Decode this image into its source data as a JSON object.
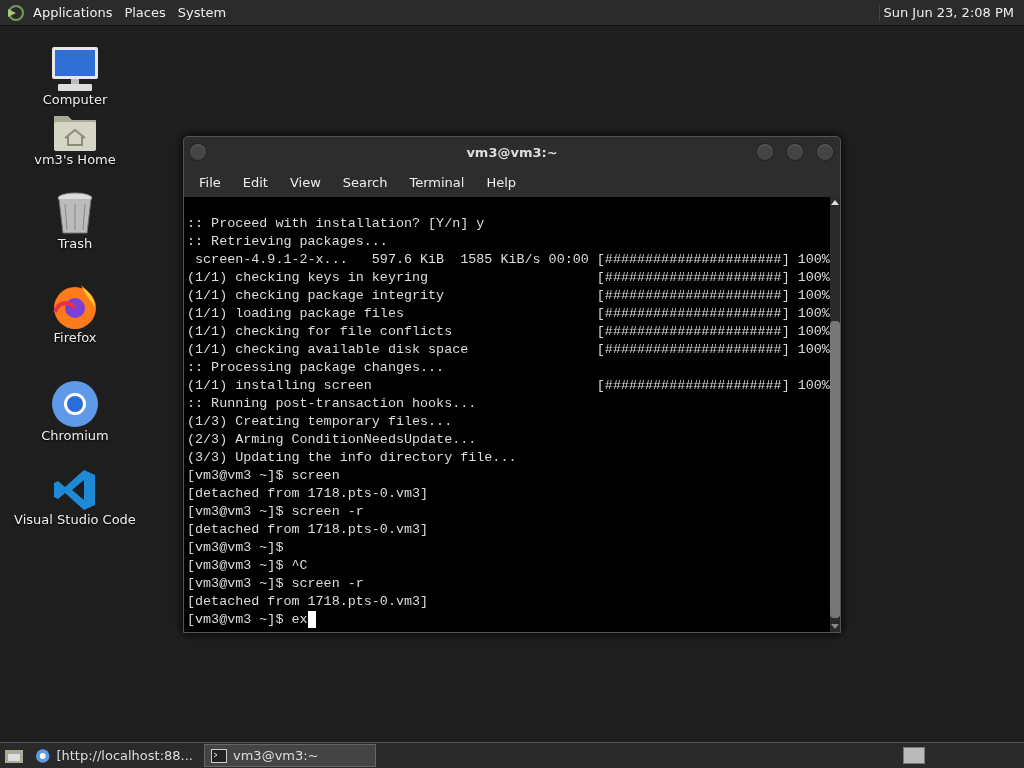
{
  "top_panel": {
    "menus": [
      "Applications",
      "Places",
      "System"
    ],
    "clock": "Sun Jun 23,  2:08 PM"
  },
  "desktop_icons": [
    {
      "kind": "computer",
      "label": "Computer"
    },
    {
      "kind": "home",
      "label": "vm3's Home"
    },
    {
      "kind": "trash",
      "label": "Trash"
    },
    {
      "kind": "firefox",
      "label": "Firefox"
    },
    {
      "kind": "chromium",
      "label": "Chromium"
    },
    {
      "kind": "vscode",
      "label": "Visual Studio Code"
    }
  ],
  "terminal_window": {
    "title": "vm3@vm3:~",
    "menus": [
      "File",
      "Edit",
      "View",
      "Search",
      "Terminal",
      "Help"
    ],
    "lines": [
      {
        "text": ":: Proceed with installation? [Y/n] y"
      },
      {
        "text": ":: Retrieving packages..."
      },
      {
        "text": " screen-4.9.1-2-x...   597.6 KiB  1585 KiB/s 00:00",
        "bar": "[######################]",
        "percent": "100%"
      },
      {
        "text": "(1/1) checking keys in keyring",
        "bar": "[######################]",
        "percent": "100%"
      },
      {
        "text": "(1/1) checking package integrity",
        "bar": "[######################]",
        "percent": "100%"
      },
      {
        "text": "(1/1) loading package files",
        "bar": "[######################]",
        "percent": "100%"
      },
      {
        "text": "(1/1) checking for file conflicts",
        "bar": "[######################]",
        "percent": "100%"
      },
      {
        "text": "(1/1) checking available disk space",
        "bar": "[######################]",
        "percent": "100%"
      },
      {
        "text": ":: Processing package changes..."
      },
      {
        "text": "(1/1) installing screen",
        "bar": "[######################]",
        "percent": "100%"
      },
      {
        "text": ":: Running post-transaction hooks..."
      },
      {
        "text": "(1/3) Creating temporary files..."
      },
      {
        "text": "(2/3) Arming ConditionNeedsUpdate..."
      },
      {
        "text": "(3/3) Updating the info directory file..."
      },
      {
        "text": "[vm3@vm3 ~]$ screen"
      },
      {
        "text": "[detached from 1718.pts-0.vm3]"
      },
      {
        "text": "[vm3@vm3 ~]$ screen -r"
      },
      {
        "text": "[detached from 1718.pts-0.vm3]"
      },
      {
        "text": "[vm3@vm3 ~]$"
      },
      {
        "text": "[vm3@vm3 ~]$ ^C"
      },
      {
        "text": "[vm3@vm3 ~]$ screen -r"
      },
      {
        "text": "[detached from 1718.pts-0.vm3]"
      },
      {
        "text": "[vm3@vm3 ~]$ ex",
        "cursor": true
      }
    ]
  },
  "taskbar": {
    "tasks": [
      {
        "kind": "browser",
        "label": "[http://localhost:88...",
        "selected": false
      },
      {
        "kind": "terminal",
        "label": "vm3@vm3:~",
        "selected": true
      }
    ]
  }
}
